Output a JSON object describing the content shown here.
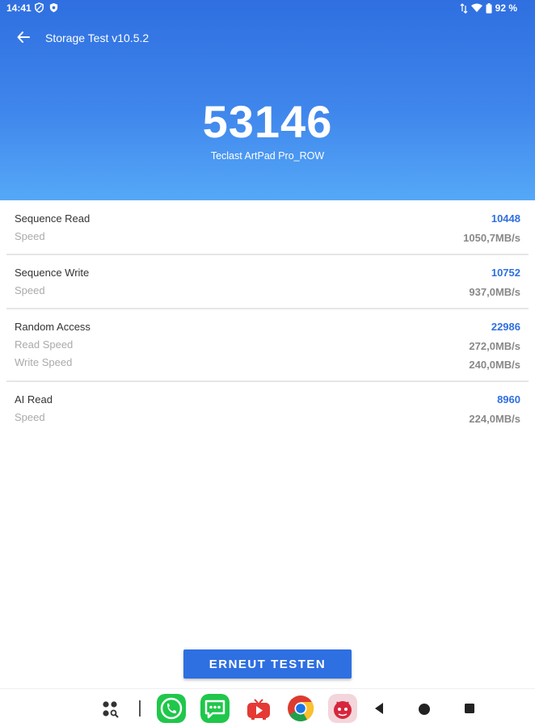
{
  "status": {
    "time": "14:41",
    "battery": "92 %"
  },
  "appbar": {
    "title": "Storage Test v10.5.2"
  },
  "result": {
    "score": "53146",
    "device": "Teclast ArtPad Pro_ROW"
  },
  "sections": {
    "seq_read": {
      "title": "Sequence Read",
      "score": "10448",
      "label": "Speed",
      "value": "1050,7MB/s"
    },
    "seq_write": {
      "title": "Sequence Write",
      "score": "10752",
      "label": "Speed",
      "value": "937,0MB/s"
    },
    "random": {
      "title": "Random Access",
      "score": "22986",
      "read_label": "Read Speed",
      "read_value": "272,0MB/s",
      "write_label": "Write Speed",
      "write_value": "240,0MB/s"
    },
    "ai_read": {
      "title": "AI Read",
      "score": "8960",
      "label": "Speed",
      "value": "224,0MB/s"
    }
  },
  "retest_button": "ERNEUT TESTEN",
  "colors": {
    "accent": "#2f6fe0",
    "header_top": "#2f6fe0",
    "header_bottom": "#55a8f7"
  },
  "nav": {
    "icons": [
      "apps-search-icon",
      "phone-app-icon",
      "messages-app-icon",
      "video-app-icon",
      "chrome-app-icon",
      "antutu-app-icon",
      "back-triangle-icon",
      "home-circle-icon",
      "recents-square-icon"
    ]
  }
}
